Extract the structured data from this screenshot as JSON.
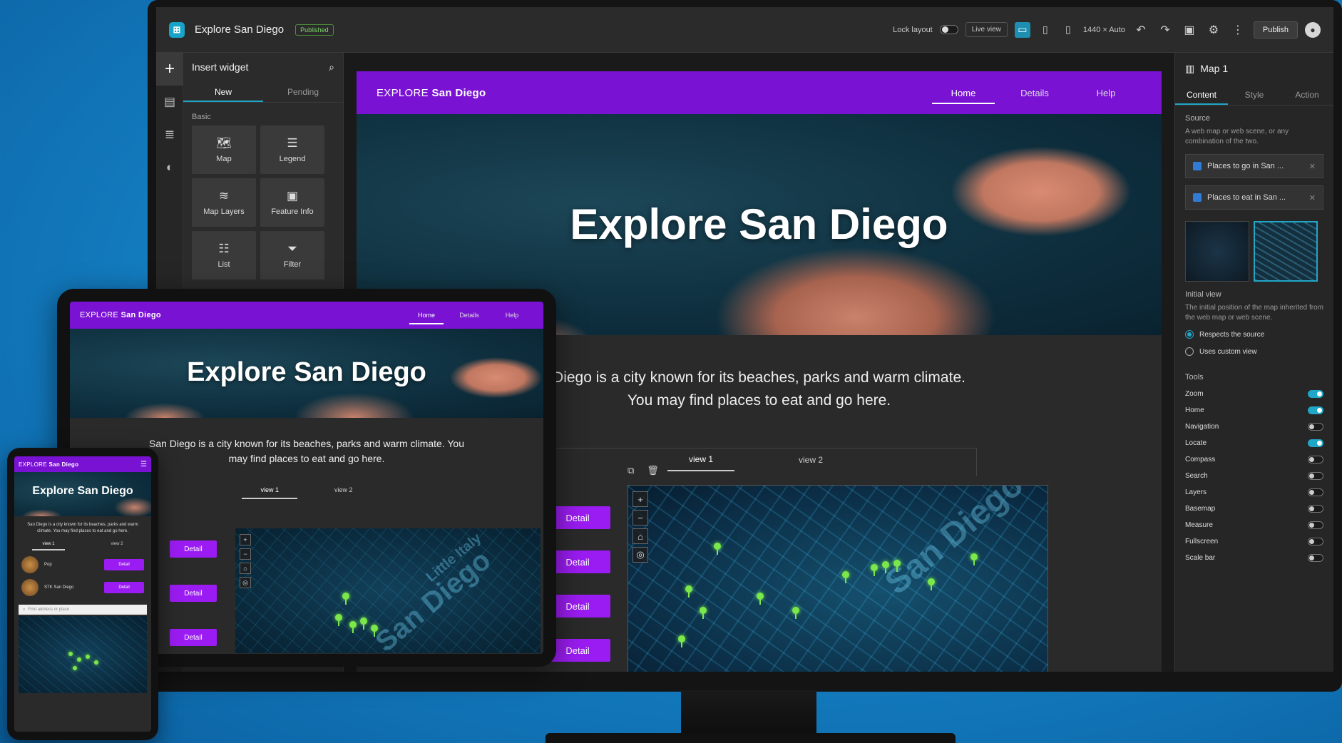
{
  "builder": {
    "app_title": "Explore San Diego",
    "status_badge": "Published",
    "lock_layout_label": "Lock layout",
    "live_view_label": "Live view",
    "screen_size": "1440 × Auto",
    "publish_label": "Publish"
  },
  "insert_panel": {
    "title": "Insert widget",
    "tabs": [
      "New",
      "Pending"
    ],
    "section": "Basic",
    "widgets": [
      {
        "label": "Map",
        "icon": "map-icon"
      },
      {
        "label": "Legend",
        "icon": "legend-icon"
      },
      {
        "label": "Map Layers",
        "icon": "layers-icon"
      },
      {
        "label": "Feature Info",
        "icon": "feature-info-icon"
      },
      {
        "label": "List",
        "icon": "list-icon"
      },
      {
        "label": "Filter",
        "icon": "filter-icon"
      }
    ]
  },
  "site": {
    "brand_prefix": "EXPLORE",
    "brand_name": "San Diego",
    "nav": [
      "Home",
      "Details",
      "Help"
    ],
    "hero_title": "Explore San Diego",
    "intro_line1": "Diego is a city known for its beaches, parks and warm climate.",
    "intro_line2": "You may find places to eat and go here.",
    "intro_full": "San Diego is a city known for its beaches, parks and warm climate. You may find places to eat and go here.",
    "view_tabs": [
      "view 1",
      "view 2"
    ],
    "detail_label": "Detail",
    "map_label_large": "San Diego",
    "map_label_little": "Little Italy"
  },
  "phone": {
    "items": [
      {
        "label": "Pop"
      },
      {
        "label": "STK San Diego"
      }
    ],
    "search_placeholder": "Find address or place"
  },
  "settings": {
    "title": "Map 1",
    "tabs": [
      "Content",
      "Style",
      "Action"
    ],
    "source_label": "Source",
    "source_desc": "A web map or web scene, or any combination of the two.",
    "sources": [
      "Places to go in San ...",
      "Places to eat in San ..."
    ],
    "initial_view_label": "Initial view",
    "initial_view_desc": "The initial position of the map inherited from the web map or web scene.",
    "option_respect": "Respects the source",
    "option_custom": "Uses custom view",
    "tools_label": "Tools",
    "tools": [
      {
        "name": "Zoom",
        "on": true
      },
      {
        "name": "Home",
        "on": true
      },
      {
        "name": "Navigation",
        "on": false
      },
      {
        "name": "Locate",
        "on": true
      },
      {
        "name": "Compass",
        "on": false
      },
      {
        "name": "Search",
        "on": false
      },
      {
        "name": "Layers",
        "on": false
      },
      {
        "name": "Basemap",
        "on": false
      },
      {
        "name": "Measure",
        "on": false
      },
      {
        "name": "Fullscreen",
        "on": false
      },
      {
        "name": "Scale bar",
        "on": false
      }
    ]
  },
  "colors": {
    "accent_purple": "#7a12d4",
    "detail_button": "#9b1cf2",
    "builder_teal": "#20a6c7",
    "map_pin": "#7be84a"
  }
}
